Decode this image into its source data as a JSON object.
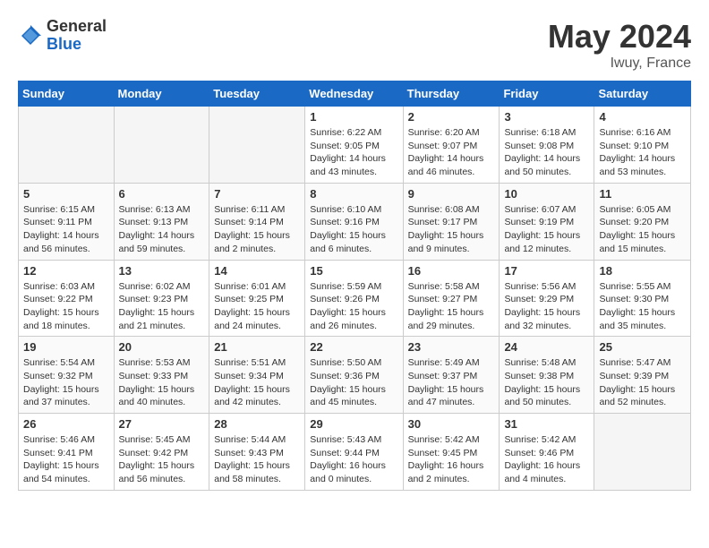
{
  "header": {
    "logo_general": "General",
    "logo_blue": "Blue",
    "month_title": "May 2024",
    "location": "Iwuy, France"
  },
  "days_of_week": [
    "Sunday",
    "Monday",
    "Tuesday",
    "Wednesday",
    "Thursday",
    "Friday",
    "Saturday"
  ],
  "weeks": [
    [
      {
        "day": "",
        "info": []
      },
      {
        "day": "",
        "info": []
      },
      {
        "day": "",
        "info": []
      },
      {
        "day": "1",
        "info": [
          "Sunrise: 6:22 AM",
          "Sunset: 9:05 PM",
          "Daylight: 14 hours",
          "and 43 minutes."
        ]
      },
      {
        "day": "2",
        "info": [
          "Sunrise: 6:20 AM",
          "Sunset: 9:07 PM",
          "Daylight: 14 hours",
          "and 46 minutes."
        ]
      },
      {
        "day": "3",
        "info": [
          "Sunrise: 6:18 AM",
          "Sunset: 9:08 PM",
          "Daylight: 14 hours",
          "and 50 minutes."
        ]
      },
      {
        "day": "4",
        "info": [
          "Sunrise: 6:16 AM",
          "Sunset: 9:10 PM",
          "Daylight: 14 hours",
          "and 53 minutes."
        ]
      }
    ],
    [
      {
        "day": "5",
        "info": [
          "Sunrise: 6:15 AM",
          "Sunset: 9:11 PM",
          "Daylight: 14 hours",
          "and 56 minutes."
        ]
      },
      {
        "day": "6",
        "info": [
          "Sunrise: 6:13 AM",
          "Sunset: 9:13 PM",
          "Daylight: 14 hours",
          "and 59 minutes."
        ]
      },
      {
        "day": "7",
        "info": [
          "Sunrise: 6:11 AM",
          "Sunset: 9:14 PM",
          "Daylight: 15 hours",
          "and 2 minutes."
        ]
      },
      {
        "day": "8",
        "info": [
          "Sunrise: 6:10 AM",
          "Sunset: 9:16 PM",
          "Daylight: 15 hours",
          "and 6 minutes."
        ]
      },
      {
        "day": "9",
        "info": [
          "Sunrise: 6:08 AM",
          "Sunset: 9:17 PM",
          "Daylight: 15 hours",
          "and 9 minutes."
        ]
      },
      {
        "day": "10",
        "info": [
          "Sunrise: 6:07 AM",
          "Sunset: 9:19 PM",
          "Daylight: 15 hours",
          "and 12 minutes."
        ]
      },
      {
        "day": "11",
        "info": [
          "Sunrise: 6:05 AM",
          "Sunset: 9:20 PM",
          "Daylight: 15 hours",
          "and 15 minutes."
        ]
      }
    ],
    [
      {
        "day": "12",
        "info": [
          "Sunrise: 6:03 AM",
          "Sunset: 9:22 PM",
          "Daylight: 15 hours",
          "and 18 minutes."
        ]
      },
      {
        "day": "13",
        "info": [
          "Sunrise: 6:02 AM",
          "Sunset: 9:23 PM",
          "Daylight: 15 hours",
          "and 21 minutes."
        ]
      },
      {
        "day": "14",
        "info": [
          "Sunrise: 6:01 AM",
          "Sunset: 9:25 PM",
          "Daylight: 15 hours",
          "and 24 minutes."
        ]
      },
      {
        "day": "15",
        "info": [
          "Sunrise: 5:59 AM",
          "Sunset: 9:26 PM",
          "Daylight: 15 hours",
          "and 26 minutes."
        ]
      },
      {
        "day": "16",
        "info": [
          "Sunrise: 5:58 AM",
          "Sunset: 9:27 PM",
          "Daylight: 15 hours",
          "and 29 minutes."
        ]
      },
      {
        "day": "17",
        "info": [
          "Sunrise: 5:56 AM",
          "Sunset: 9:29 PM",
          "Daylight: 15 hours",
          "and 32 minutes."
        ]
      },
      {
        "day": "18",
        "info": [
          "Sunrise: 5:55 AM",
          "Sunset: 9:30 PM",
          "Daylight: 15 hours",
          "and 35 minutes."
        ]
      }
    ],
    [
      {
        "day": "19",
        "info": [
          "Sunrise: 5:54 AM",
          "Sunset: 9:32 PM",
          "Daylight: 15 hours",
          "and 37 minutes."
        ]
      },
      {
        "day": "20",
        "info": [
          "Sunrise: 5:53 AM",
          "Sunset: 9:33 PM",
          "Daylight: 15 hours",
          "and 40 minutes."
        ]
      },
      {
        "day": "21",
        "info": [
          "Sunrise: 5:51 AM",
          "Sunset: 9:34 PM",
          "Daylight: 15 hours",
          "and 42 minutes."
        ]
      },
      {
        "day": "22",
        "info": [
          "Sunrise: 5:50 AM",
          "Sunset: 9:36 PM",
          "Daylight: 15 hours",
          "and 45 minutes."
        ]
      },
      {
        "day": "23",
        "info": [
          "Sunrise: 5:49 AM",
          "Sunset: 9:37 PM",
          "Daylight: 15 hours",
          "and 47 minutes."
        ]
      },
      {
        "day": "24",
        "info": [
          "Sunrise: 5:48 AM",
          "Sunset: 9:38 PM",
          "Daylight: 15 hours",
          "and 50 minutes."
        ]
      },
      {
        "day": "25",
        "info": [
          "Sunrise: 5:47 AM",
          "Sunset: 9:39 PM",
          "Daylight: 15 hours",
          "and 52 minutes."
        ]
      }
    ],
    [
      {
        "day": "26",
        "info": [
          "Sunrise: 5:46 AM",
          "Sunset: 9:41 PM",
          "Daylight: 15 hours",
          "and 54 minutes."
        ]
      },
      {
        "day": "27",
        "info": [
          "Sunrise: 5:45 AM",
          "Sunset: 9:42 PM",
          "Daylight: 15 hours",
          "and 56 minutes."
        ]
      },
      {
        "day": "28",
        "info": [
          "Sunrise: 5:44 AM",
          "Sunset: 9:43 PM",
          "Daylight: 15 hours",
          "and 58 minutes."
        ]
      },
      {
        "day": "29",
        "info": [
          "Sunrise: 5:43 AM",
          "Sunset: 9:44 PM",
          "Daylight: 16 hours",
          "and 0 minutes."
        ]
      },
      {
        "day": "30",
        "info": [
          "Sunrise: 5:42 AM",
          "Sunset: 9:45 PM",
          "Daylight: 16 hours",
          "and 2 minutes."
        ]
      },
      {
        "day": "31",
        "info": [
          "Sunrise: 5:42 AM",
          "Sunset: 9:46 PM",
          "Daylight: 16 hours",
          "and 4 minutes."
        ]
      },
      {
        "day": "",
        "info": []
      }
    ]
  ]
}
